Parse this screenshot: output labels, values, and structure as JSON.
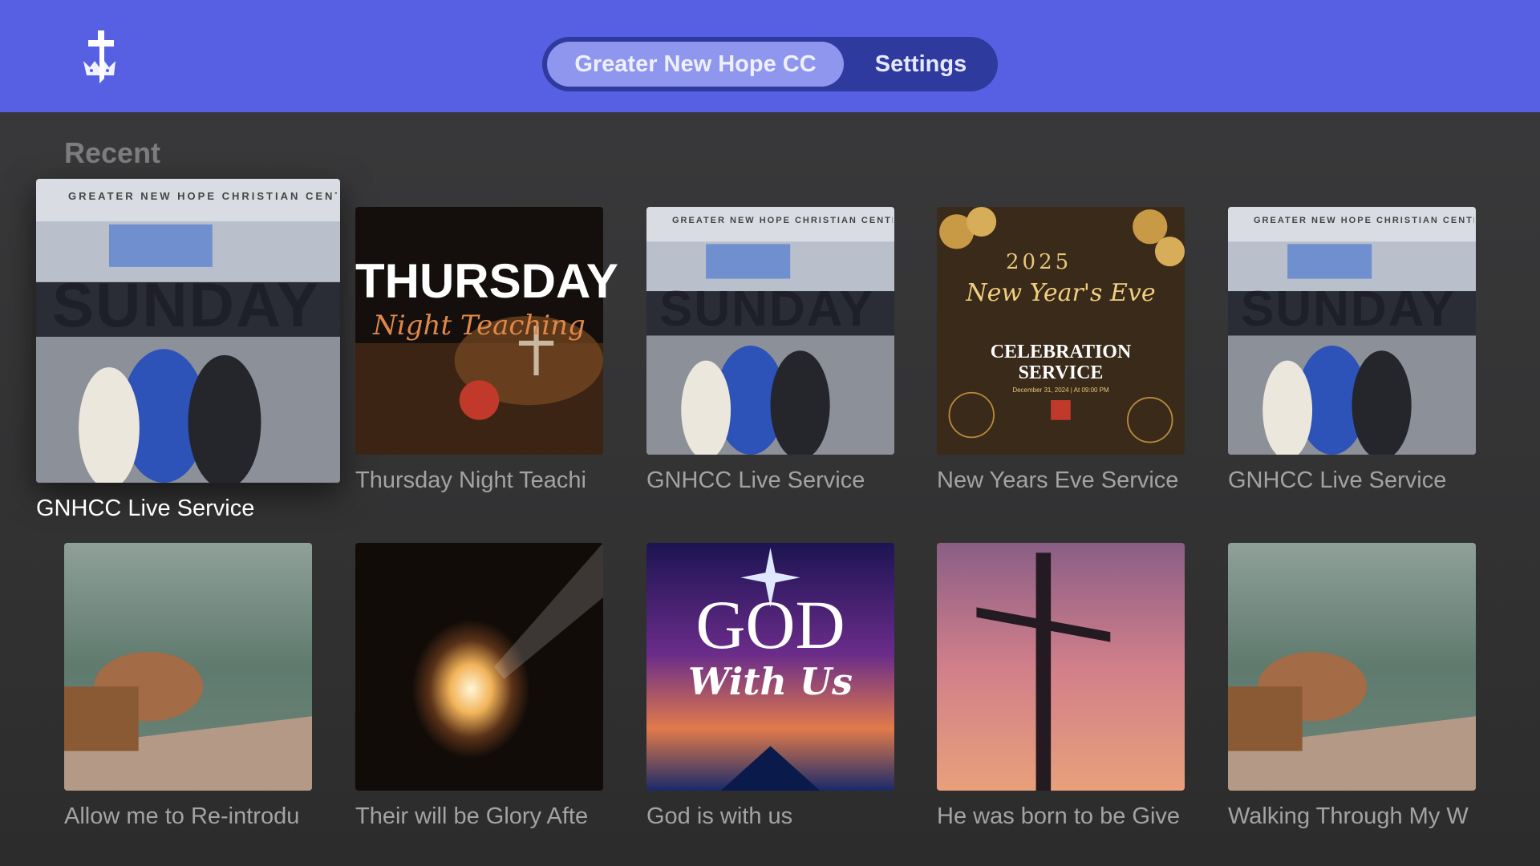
{
  "header": {
    "logo_icon": "church-cross-crown-icon",
    "tabs": [
      {
        "label": "Greater New Hope CC",
        "selected": true
      },
      {
        "label": "Settings",
        "selected": false
      }
    ]
  },
  "section": {
    "title": "Recent",
    "items": [
      {
        "title": "GNHCC Live Service",
        "banner": "GREATER NEW HOPE CHRISTIAN CENTE",
        "art_word": "SUNDAY",
        "focused": true
      },
      {
        "title": "Thursday Night Teachi",
        "art_title": "THURSDAY",
        "art_script": "Night Teaching"
      },
      {
        "title": "GNHCC Live Service",
        "banner": "GREATER NEW HOPE CHRISTIAN CENTE",
        "art_word": "SUNDAY"
      },
      {
        "title": "New Years Eve Service",
        "art_year": "2025",
        "art_script": "New Year's Eve",
        "art_line1": "CELEBRATION",
        "art_line2": "SERVICE",
        "art_small": "December 31, 2024 | At 09:00 PM"
      },
      {
        "title": "GNHCC Live Service",
        "banner": "GREATER NEW HOPE CHRISTIAN CENTE",
        "art_word": "SUNDAY"
      },
      {
        "title": "Allow me to Re-introdu"
      },
      {
        "title": "Their will be Glory Afte"
      },
      {
        "title": "God is with us",
        "art_title": "GOD",
        "art_script": "With Us"
      },
      {
        "title": "He was born to be Give"
      },
      {
        "title": "Walking Through My W"
      }
    ]
  },
  "colors": {
    "header": "#5760e2",
    "tab_pill": "#2f3a9e",
    "tab_selected": "#8f96ee",
    "background": "#363638"
  }
}
